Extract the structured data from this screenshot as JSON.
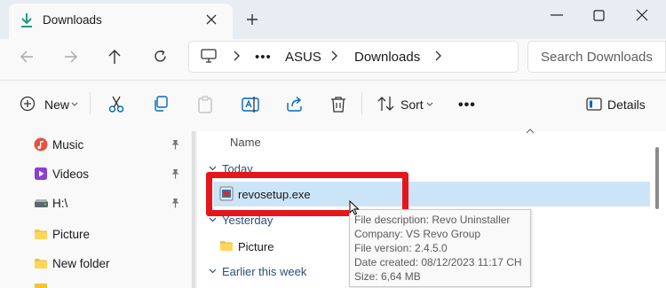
{
  "window": {
    "tab_title": "Downloads",
    "colors": {
      "accent": "#0067c0",
      "selection": "#cce4f7",
      "highlight_box": "#e5161c",
      "folder": "#f4c33a"
    }
  },
  "address_bar": {
    "overflow": "•••",
    "crumbs": [
      "ASUS",
      "Downloads"
    ]
  },
  "search": {
    "placeholder": "Search Downloads"
  },
  "command_bar": {
    "new_label": "New",
    "sort_label": "Sort",
    "more": "•••",
    "details_label": "Details",
    "icons": [
      "cut-icon",
      "copy-icon",
      "paste-icon",
      "rename-icon",
      "share-icon",
      "delete-icon"
    ]
  },
  "sidebar": {
    "items": [
      {
        "label": "Music",
        "icon": "music-icon",
        "pinned": true
      },
      {
        "label": "Videos",
        "icon": "videos-icon",
        "pinned": true
      },
      {
        "label": "H:\\",
        "icon": "drive-icon",
        "pinned": true
      },
      {
        "label": "Picture",
        "icon": "folder-icon",
        "pinned": false
      },
      {
        "label": "New folder",
        "icon": "folder-icon",
        "pinned": false
      }
    ]
  },
  "file_list": {
    "column_name": "Name",
    "groups": [
      {
        "label": "Today",
        "items": [
          {
            "name": "revosetup.exe",
            "selected": true
          }
        ]
      },
      {
        "label": "Yesterday",
        "items": [
          {
            "name": "Picture",
            "type": "folder"
          }
        ]
      },
      {
        "label": "Earlier this week",
        "items": []
      }
    ]
  },
  "tooltip": {
    "description": "File description: Revo Uninstaller",
    "company": "Company: VS Revo Group",
    "version": "File version: 2.4.5.0",
    "created": "Date created: 08/12/2023 11:17 CH",
    "size": "Size: 6,64 MB"
  }
}
